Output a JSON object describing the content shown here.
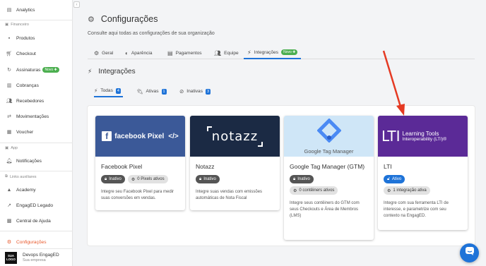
{
  "sidebar": {
    "items": [
      {
        "label": "Analytics",
        "icon": "analytics-icon"
      },
      {
        "label": "Produtos",
        "icon": "box-icon"
      },
      {
        "label": "Checkout",
        "icon": "cart-icon"
      },
      {
        "label": "Assinaturas",
        "icon": "refresh-icon",
        "badge": "Novo ✚"
      },
      {
        "label": "Cobranças",
        "icon": "receipt-icon"
      },
      {
        "label": "Recebedores",
        "icon": "people-icon"
      },
      {
        "label": "Movimentações",
        "icon": "transfer-icon"
      },
      {
        "label": "Voucher",
        "icon": "voucher-icon"
      },
      {
        "label": "Notificações",
        "icon": "bell-icon"
      },
      {
        "label": "Academy",
        "icon": "academy-icon"
      },
      {
        "label": "EngagED Legado",
        "icon": "external-icon"
      },
      {
        "label": "Central de Ajuda",
        "icon": "help-icon"
      },
      {
        "label": "Configurações",
        "icon": "gear-icon"
      }
    ],
    "sections": {
      "financeiro": "Financeiro",
      "app": "App",
      "links": "Links auxiliares"
    },
    "user": {
      "logo": "SUA LOGO",
      "name": "Devops EngagED",
      "org": "Sua empresa"
    }
  },
  "page": {
    "title": "Configurações",
    "subtitle": "Consulte aqui todas as configurações de sua organização",
    "tabs": [
      "Geral",
      "Aparência",
      "Pagamentos",
      "Equipe",
      "Integrações"
    ],
    "tab_new_badge": "Novo ✚",
    "section_title": "Integrações",
    "subtabs": [
      {
        "label": "Todas",
        "count": "4"
      },
      {
        "label": "Ativas",
        "count": "1"
      },
      {
        "label": "Inativas",
        "count": "3"
      }
    ]
  },
  "cards": [
    {
      "title": "Facebook Pixel",
      "banner_text": "facebook Pixel",
      "status": "Inativo",
      "info": "0 Pixels ativos",
      "description": "Integre seu Facebook Pixel para medir suas conversões em vendas.",
      "banner_color": "#3b5998"
    },
    {
      "title": "Notazz",
      "banner_text": "notazz",
      "status": "Inativo",
      "description": "Integre suas vendas com emissões automáticas de Nota Fiscal",
      "banner_color": "#1b2a44"
    },
    {
      "title": "Google Tag Manager (GTM)",
      "banner_text": "Google Tag Manager",
      "status": "Inativo",
      "info": "0 contêiners ativos",
      "description": "Integre seus contêiners do GTM com seus Checkouts e Área de Membros (LMS)",
      "banner_color": "#cfe6f7"
    },
    {
      "title": "LTI",
      "banner_text_1": "Learning Tools",
      "banner_text_2": "Interoperability (LTI)®",
      "banner_logo": "LTI",
      "status": "Ativo",
      "info": "1 integração ativa",
      "description": "Integre com sua ferramenta LTI de interesse, e parametrize com seu contexto na EngagED.",
      "banner_color": "#5b2a97"
    }
  ],
  "colors": {
    "accent": "#1e73d8",
    "active_sidebar": "#e8572a",
    "annotation_arrow": "#e53a23"
  }
}
